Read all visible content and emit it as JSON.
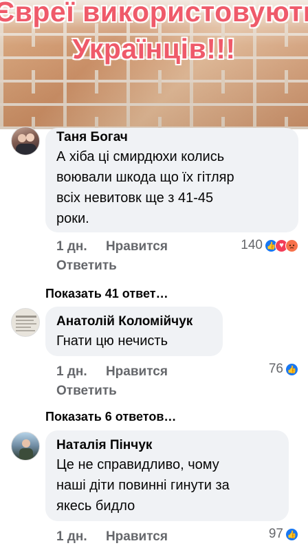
{
  "banner": {
    "line1": "Євреї використовують",
    "line2": "Українців!!!"
  },
  "comments": [
    {
      "author": "Таня Богач",
      "text_lines": [
        "А хіба ці смирдюхи колись",
        "воювали шкода що їх гітляр",
        "всіх невитовк ще з 41-45",
        "роки."
      ],
      "time": "1 дн.",
      "like_label": "Нравится",
      "reply_label": "Ответить",
      "reaction_count": "140",
      "reactions": [
        "like-icon",
        "love-icon",
        "angry-icon"
      ]
    },
    {
      "author": "Анатолій Коломійчук",
      "text_lines": [
        "Гнати  цю нечисть"
      ],
      "time": "1 дн.",
      "like_label": "Нравится",
      "reply_label": "Ответить",
      "reaction_count": "76",
      "reactions": [
        "like-icon"
      ]
    },
    {
      "author": "Наталія Пінчук",
      "text_lines": [
        "Це не справидливо, чому",
        "наші діти повинні гинути за",
        "якесь бидло"
      ],
      "time": "1 дн.",
      "like_label": "Нравится",
      "reaction_count": "97",
      "reactions": [
        "like-icon"
      ]
    }
  ],
  "show_replies": [
    "Показать 41 ответ…",
    "Показать 6 ответов…"
  ],
  "colors": {
    "banner_text": "#ef5a6a",
    "bubble_bg": "#f0f2f5",
    "meta_text": "#65676b",
    "like_blue": "#1877f2"
  }
}
